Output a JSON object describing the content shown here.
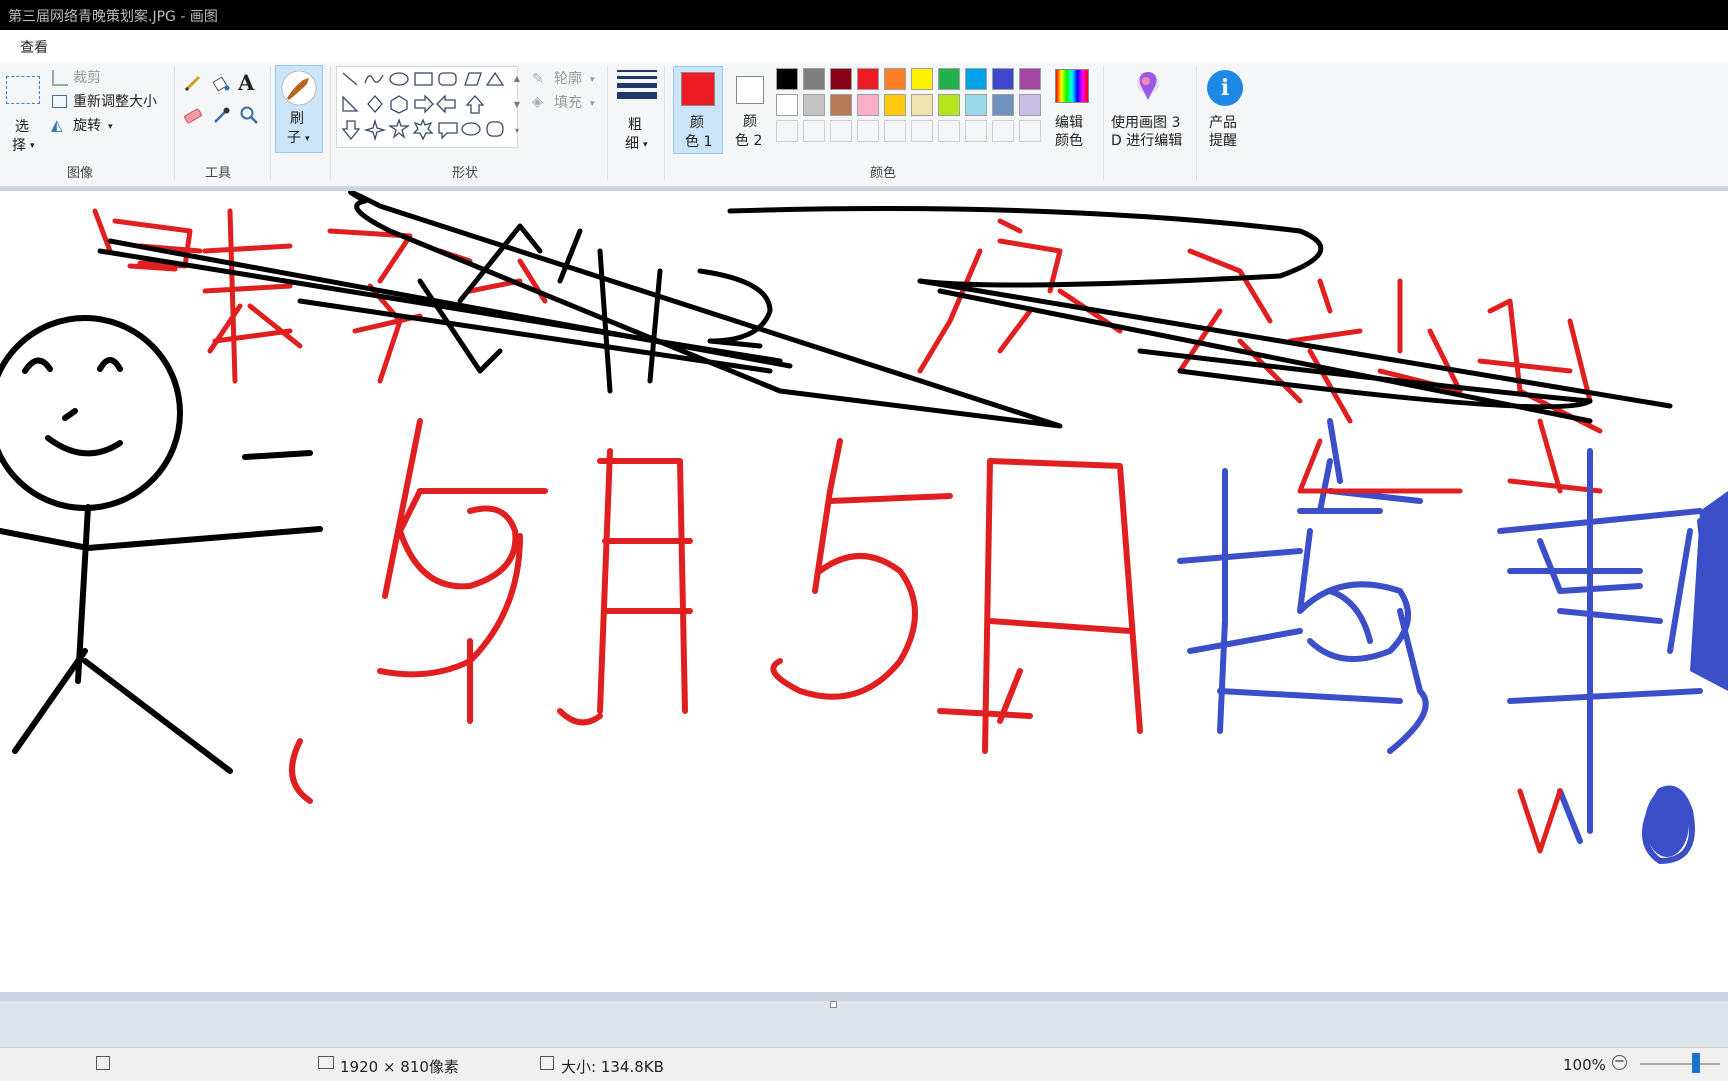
{
  "window": {
    "title": "第三届网络青晚策划案.JPG - 画图"
  },
  "menu": {
    "view": "查看"
  },
  "ribbon": {
    "image": {
      "group_label": "图像",
      "select_l1": "选",
      "select_l2": "择",
      "crop": "裁剪",
      "resize": "重新调整大小",
      "rotate": "旋转"
    },
    "tools": {
      "group_label": "工具"
    },
    "brush": {
      "l1": "刷",
      "l2": "子"
    },
    "shapes": {
      "group_label": "形状",
      "outline": "轮廓",
      "fill": "填充"
    },
    "size": {
      "l1": "粗",
      "l2": "细"
    },
    "color1": {
      "l1": "颜",
      "l2": "色 1",
      "value": "#ed1c24"
    },
    "color2": {
      "l1": "颜",
      "l2": "色 2",
      "value": "#ffffff"
    },
    "colors": {
      "group_label": "颜色",
      "row1": [
        "#000000",
        "#7f7f7f",
        "#880015",
        "#ed1c24",
        "#ff7f27",
        "#fff200",
        "#22b14c",
        "#00a2e8",
        "#3f48cc",
        "#a349a4"
      ],
      "row2": [
        "#ffffff",
        "#c3c3c3",
        "#b97a57",
        "#ffaec9",
        "#ffc90e",
        "#efe4b0",
        "#b5e61d",
        "#99d9ea",
        "#7092be",
        "#c8bfe7"
      ],
      "edit_l1": "编辑",
      "edit_l2": "颜色"
    },
    "paint3d": {
      "l1": "使用画图 3",
      "l2": "D 进行编辑"
    },
    "product": {
      "l1": "产品",
      "l2": "提醒"
    }
  },
  "status": {
    "dimensions": "1920 × 810像素",
    "size": "大小: 134.8KB",
    "zoom": "100%"
  }
}
